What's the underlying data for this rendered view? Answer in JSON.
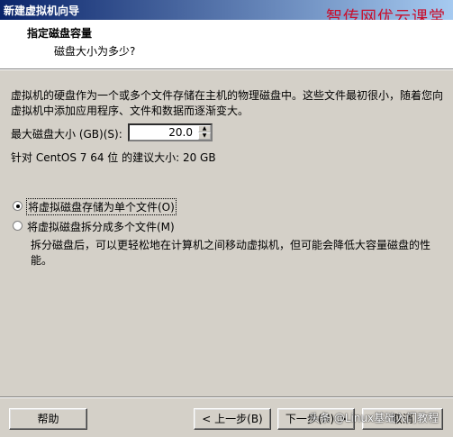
{
  "window": {
    "title": "新建虚拟机向导"
  },
  "watermark_top": "智传网优云课堂",
  "header": {
    "title": "指定磁盘容量",
    "subtitle": "磁盘大小为多少?"
  },
  "description": "虚拟机的硬盘作为一个或多个文件存储在主机的物理磁盘中。这些文件最初很小，随着您向虚拟机中添加应用程序、文件和数据而逐渐变大。",
  "disk_size": {
    "label": "最大磁盘大小 (GB)(S):",
    "value": "20.0"
  },
  "recommend": "针对 CentOS 7 64 位 的建议大小: 20 GB",
  "options": [
    {
      "label": "将虚拟磁盘存储为单个文件(O)",
      "checked": true
    },
    {
      "label": "将虚拟磁盘拆分成多个文件(M)",
      "checked": false
    }
  ],
  "split_note": "拆分磁盘后，可以更轻松地在计算机之间移动虚拟机，但可能会降低大容量磁盘的性能。",
  "buttons": {
    "help": "帮助",
    "back": "< 上一步(B)",
    "next": "下一步(N) >",
    "cancel": "取消"
  },
  "watermark_bottom": "头条 @Linux基础入门教程"
}
